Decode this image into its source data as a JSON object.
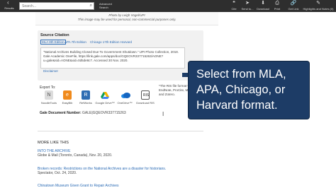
{
  "toolbar": {
    "back_label": "Results",
    "search_placeholder": "Search...",
    "advanced_label": "Advanced Search",
    "tools": [
      {
        "label": "Cite",
        "icon": "cite-icon"
      },
      {
        "label": "Send to...",
        "icon": "send-icon"
      },
      {
        "label": "Download",
        "icon": "download-icon"
      },
      {
        "label": "Print",
        "icon": "print-icon"
      },
      {
        "label": "Get Link",
        "icon": "link-icon"
      },
      {
        "label": "Highlights and Notes (0)",
        "icon": "highlight-icon"
      }
    ]
  },
  "image_credit": {
    "line1": "Photo by Leigh Vogel/UPI",
    "line2": "This image may be used for personal, non-commercial purposes only."
  },
  "citation": {
    "title": "Source Citation",
    "tabs": [
      "MLA 8th Edition",
      "APA 7th Edition",
      "Chicago 17th Edition",
      "Harvard"
    ],
    "active_tab": "MLA 8th Edition",
    "text": "\"National Archives Building Closed Due To Government Shutdown.\" UPI Photo Collection, 2018. Gale Academic OneFile, https://link.gale.com/apps/doc/GQEOVR337715263/AONE?u=gale&sid=AONE&xid=0d5de8c7. Accessed 30 Nov. 2020.",
    "disclaimer": "Disclaimer"
  },
  "export": {
    "label": "Export To:",
    "items": [
      {
        "label": "NoodleTools",
        "icon": "noodletools-icon",
        "color": "#d9d9d9"
      },
      {
        "label": "EasyBib",
        "icon": "easybib-icon",
        "color": "#f08a1c"
      },
      {
        "label": "RefWorks",
        "icon": "refworks-icon",
        "color": "#2f6db3"
      },
      {
        "label": "Google Drive™",
        "icon": "google-drive-icon",
        "color": "#ffffff"
      },
      {
        "label": "OneDrive™",
        "icon": "onedrive-icon",
        "color": "#ffffff"
      },
      {
        "label": "Download RIS",
        "icon": "ris-icon",
        "color": "#ffffff"
      }
    ],
    "ris_note": "*The RIS file format with EndNote, ProCite, Manager, and Zotero."
  },
  "document": {
    "label": "Gale Document Number:",
    "value": "GALE|GQEOVR337715263"
  },
  "more_like_this": {
    "title": "MORE LIKE THIS",
    "articles": [
      {
        "title": "INTO THE ARCHIVE",
        "meta": "Globe & Mail (Toronto, Canada), Nov. 20, 2020."
      },
      {
        "title": "Broken records: Restrictions on the National Archives are a disaster for historians.",
        "meta": "Spectator, Oct. 24, 2020."
      },
      {
        "title": "Chinatown Museum Given Grant to Repair Archives",
        "meta": ""
      }
    ]
  },
  "callout": {
    "text": "Select from MLA, APA, Chicago, or Harvard format."
  }
}
